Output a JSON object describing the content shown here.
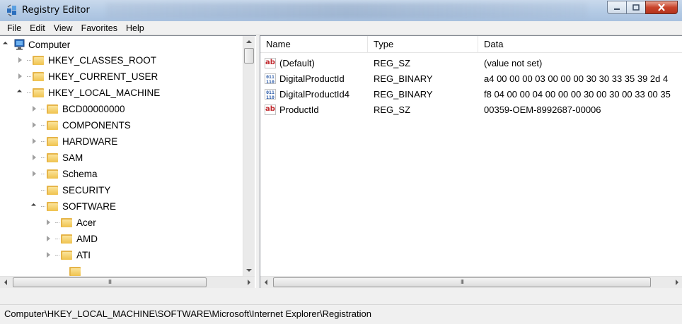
{
  "window": {
    "title": "Registry Editor",
    "controls": {
      "minimize": "minimize-icon",
      "maximize": "maximize-icon",
      "close": "close-icon"
    }
  },
  "menu": [
    "File",
    "Edit",
    "View",
    "Favorites",
    "Help"
  ],
  "tree": {
    "root": "Computer",
    "hives": [
      "HKEY_CLASSES_ROOT",
      "HKEY_CURRENT_USER",
      "HKEY_LOCAL_MACHINE"
    ],
    "hklm_children": [
      "BCD00000000",
      "COMPONENTS",
      "HARDWARE",
      "SAM",
      "Schema",
      "SECURITY",
      "SOFTWARE"
    ],
    "software_children": [
      "Acer",
      "AMD",
      "ATI"
    ],
    "scroll_thumb_label": "III"
  },
  "list": {
    "columns": {
      "name": "Name",
      "type": "Type",
      "data": "Data"
    },
    "rows": [
      {
        "icon": "string-value-icon",
        "name": "(Default)",
        "type": "REG_SZ",
        "data": "(value not set)"
      },
      {
        "icon": "binary-value-icon",
        "name": "DigitalProductId",
        "type": "REG_BINARY",
        "data": "a4 00 00 00 03 00 00 00 30 30 33 35 39 2d 4"
      },
      {
        "icon": "binary-value-icon",
        "name": "DigitalProductId4",
        "type": "REG_BINARY",
        "data": "f8 04 00 00 04 00 00 00 30 00 30 00 33 00 35"
      },
      {
        "icon": "string-value-icon",
        "name": "ProductId",
        "type": "REG_SZ",
        "data": "00359-OEM-8992687-00006"
      }
    ],
    "scroll_thumb_label": "III"
  },
  "status": {
    "path": "Computer\\HKEY_LOCAL_MACHINE\\SOFTWARE\\Microsoft\\Internet Explorer\\Registration"
  },
  "colors": {
    "titlebar": "#b7cde6",
    "close_button": "#c8442b",
    "folder": "#f0c24e",
    "string_icon": "#c0282d",
    "binary_icon": "#2a5aa8"
  }
}
